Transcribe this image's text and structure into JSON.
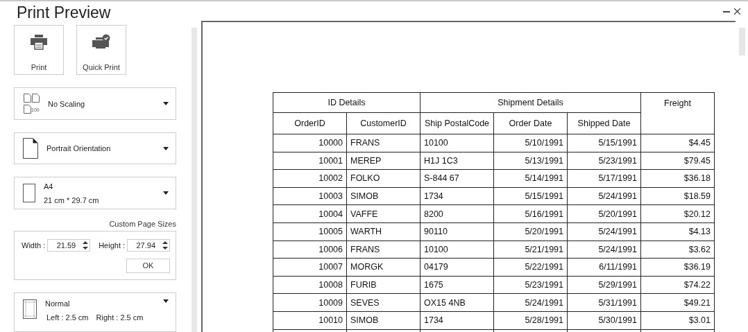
{
  "window": {
    "title": "Print Preview"
  },
  "actions": [
    {
      "kind": "print",
      "label": "Print"
    },
    {
      "kind": "quick",
      "label": "Quick Print"
    }
  ],
  "scaling": {
    "label": "No Scaling",
    "icon_caption": "100"
  },
  "orientation": {
    "label": "Portrait Orientation"
  },
  "paper": {
    "name": "A4",
    "size": "21 cm * 29.7 cm"
  },
  "custom_size": {
    "heading": "Custom Page Sizes",
    "width_label": "Width :",
    "width_value": "21.59",
    "height_label": "Height :",
    "height_value": "27.94",
    "ok": "OK"
  },
  "margins": {
    "name": "Normal",
    "left": "Left : 2.5 cm",
    "right": "Right : 2.5 cm"
  },
  "table": {
    "groups": [
      {
        "label": "ID Details"
      },
      {
        "label": "Shipment Details"
      }
    ],
    "freight_header": "Freight",
    "columns": [
      "OrderID",
      "CustomerID",
      "Ship PostalCode",
      "Order Date",
      "Shipped Date"
    ],
    "rows": [
      [
        "10000",
        "FRANS",
        "10100",
        "5/10/1991",
        "5/15/1991",
        "$4.45"
      ],
      [
        "10001",
        "MEREP",
        "H1J 1C3",
        "5/13/1991",
        "5/23/1991",
        "$79.45"
      ],
      [
        "10002",
        "FOLKO",
        "S-844 67",
        "5/14/1991",
        "5/17/1991",
        "$36.18"
      ],
      [
        "10003",
        "SIMOB",
        "1734",
        "5/15/1991",
        "5/24/1991",
        "$18.59"
      ],
      [
        "10004",
        "VAFFE",
        "8200",
        "5/16/1991",
        "5/20/1991",
        "$20.12"
      ],
      [
        "10005",
        "WARTH",
        "90110",
        "5/20/1991",
        "5/24/1991",
        "$4.13"
      ],
      [
        "10006",
        "FRANS",
        "10100",
        "5/21/1991",
        "5/24/1991",
        "$3.62"
      ],
      [
        "10007",
        "MORGK",
        "04179",
        "5/22/1991",
        "6/11/1991",
        "$36.19"
      ],
      [
        "10008",
        "FURIB",
        "1675",
        "5/23/1991",
        "5/29/1991",
        "$74.22"
      ],
      [
        "10009",
        "SEVES",
        "OX15 4NB",
        "5/24/1991",
        "5/31/1991",
        "$49.21"
      ],
      [
        "10010",
        "SIMOB",
        "1734",
        "5/28/1991",
        "5/30/1991",
        "$3.01"
      ]
    ]
  }
}
